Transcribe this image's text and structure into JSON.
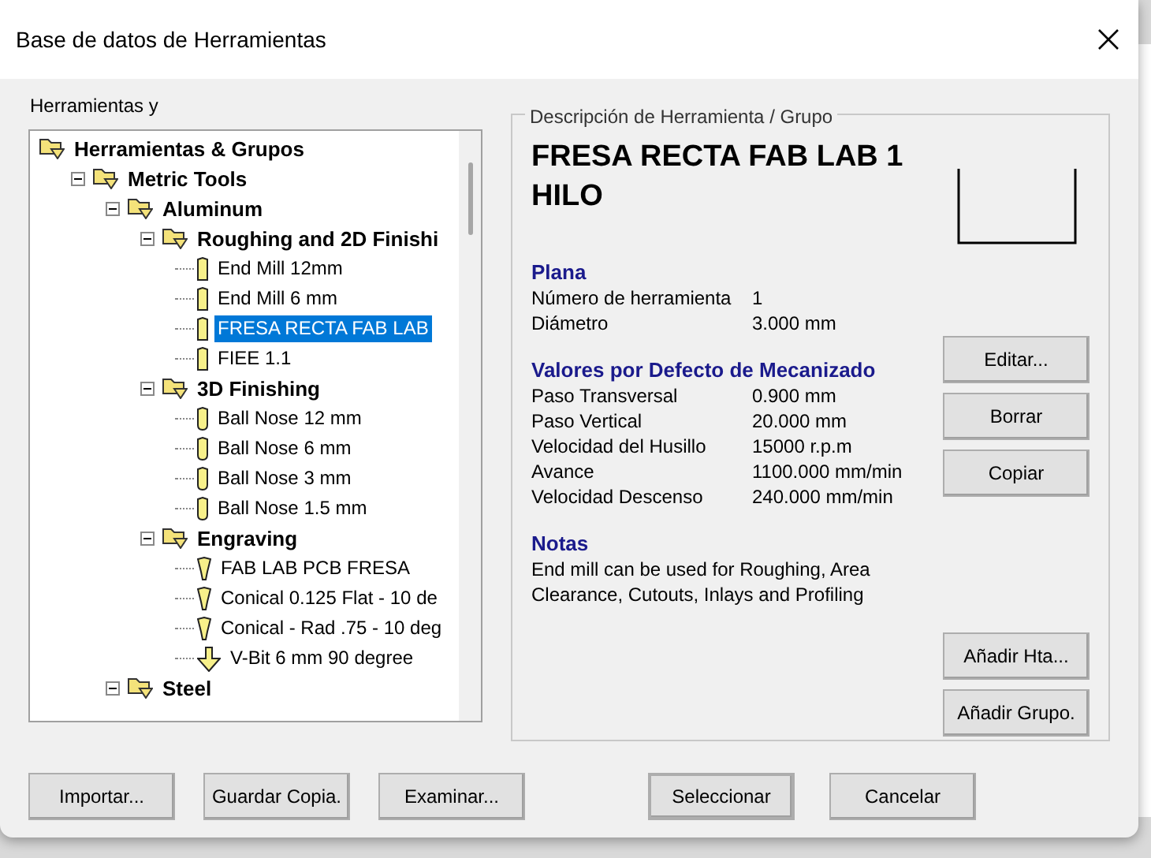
{
  "window": {
    "title": "Base de datos de Herramientas"
  },
  "tree_panel": {
    "label": "Herramientas y"
  },
  "tree": [
    {
      "label": "Herramientas & Grupos",
      "kind": "group",
      "root": true,
      "selected": false,
      "children": [
        {
          "label": "Metric Tools",
          "kind": "group",
          "expanded": true,
          "selected": false,
          "children": [
            {
              "label": "Aluminum",
              "kind": "group",
              "expanded": true,
              "selected": false,
              "children": [
                {
                  "label": "Roughing and 2D Finishi",
                  "kind": "group",
                  "expanded": true,
                  "selected": false,
                  "children": [
                    {
                      "label": "End Mill 12mm",
                      "kind": "end-mill",
                      "selected": false
                    },
                    {
                      "label": "End Mill 6 mm",
                      "kind": "end-mill",
                      "selected": false
                    },
                    {
                      "label": "FRESA RECTA FAB LAB",
                      "kind": "end-mill",
                      "selected": true
                    },
                    {
                      "label": "FIEE 1.1",
                      "kind": "end-mill",
                      "selected": false
                    }
                  ]
                },
                {
                  "label": "3D Finishing",
                  "kind": "group",
                  "expanded": true,
                  "selected": false,
                  "children": [
                    {
                      "label": "Ball Nose 12 mm",
                      "kind": "ball-nose",
                      "selected": false
                    },
                    {
                      "label": "Ball Nose 6 mm",
                      "kind": "ball-nose",
                      "selected": false
                    },
                    {
                      "label": "Ball Nose 3 mm",
                      "kind": "ball-nose",
                      "selected": false
                    },
                    {
                      "label": "Ball Nose 1.5 mm",
                      "kind": "ball-nose",
                      "selected": false
                    }
                  ]
                },
                {
                  "label": "Engraving",
                  "kind": "group",
                  "expanded": true,
                  "selected": false,
                  "children": [
                    {
                      "label": "FAB LAB PCB FRESA",
                      "kind": "engraving",
                      "selected": false
                    },
                    {
                      "label": "Conical 0.125 Flat - 10 de",
                      "kind": "engraving",
                      "selected": false
                    },
                    {
                      "label": "Conical - Rad .75 - 10 deg",
                      "kind": "engraving",
                      "selected": false
                    },
                    {
                      "label": "V-Bit 6 mm 90 degree",
                      "kind": "v-bit",
                      "selected": false
                    }
                  ]
                }
              ]
            },
            {
              "label": "Steel",
              "kind": "group",
              "expanded": true,
              "selected": false
            }
          ]
        }
      ]
    }
  ],
  "description": {
    "legend": "Descripción de Herramienta / Grupo",
    "title": "FRESA RECTA FAB LAB 1 HILO",
    "sections": [
      {
        "heading": "Plana",
        "rows": [
          {
            "label": "Número de herramienta",
            "value": "1"
          },
          {
            "label": "Diámetro",
            "value": "3.000 mm"
          }
        ]
      },
      {
        "heading": "Valores por Defecto de Mecanizado",
        "rows": [
          {
            "label": "Paso Transversal",
            "value": "0.900 mm"
          },
          {
            "label": "Paso Vertical",
            "value": "20.000 mm"
          },
          {
            "label": "Velocidad del Husillo",
            "value": "15000 r.p.m"
          },
          {
            "label": "Avance",
            "value": "1100.000 mm/min"
          },
          {
            "label": "Velocidad Descenso",
            "value": "240.000 mm/min"
          }
        ]
      },
      {
        "heading": "Notas",
        "text": "End mill can be used for Roughing, Area Clearance, Cutouts, Inlays and Profiling"
      }
    ],
    "actions": [
      "Editar...",
      "Borrar",
      "Copiar"
    ],
    "add_actions": [
      "Añadir Hta...",
      "Añadir Grupo."
    ]
  },
  "footer_left": [
    "Importar...",
    "Guardar Copia.",
    "Examinar..."
  ],
  "footer_right": [
    {
      "label": "Seleccionar",
      "default": true
    },
    {
      "label": "Cancelar",
      "default": false
    }
  ]
}
